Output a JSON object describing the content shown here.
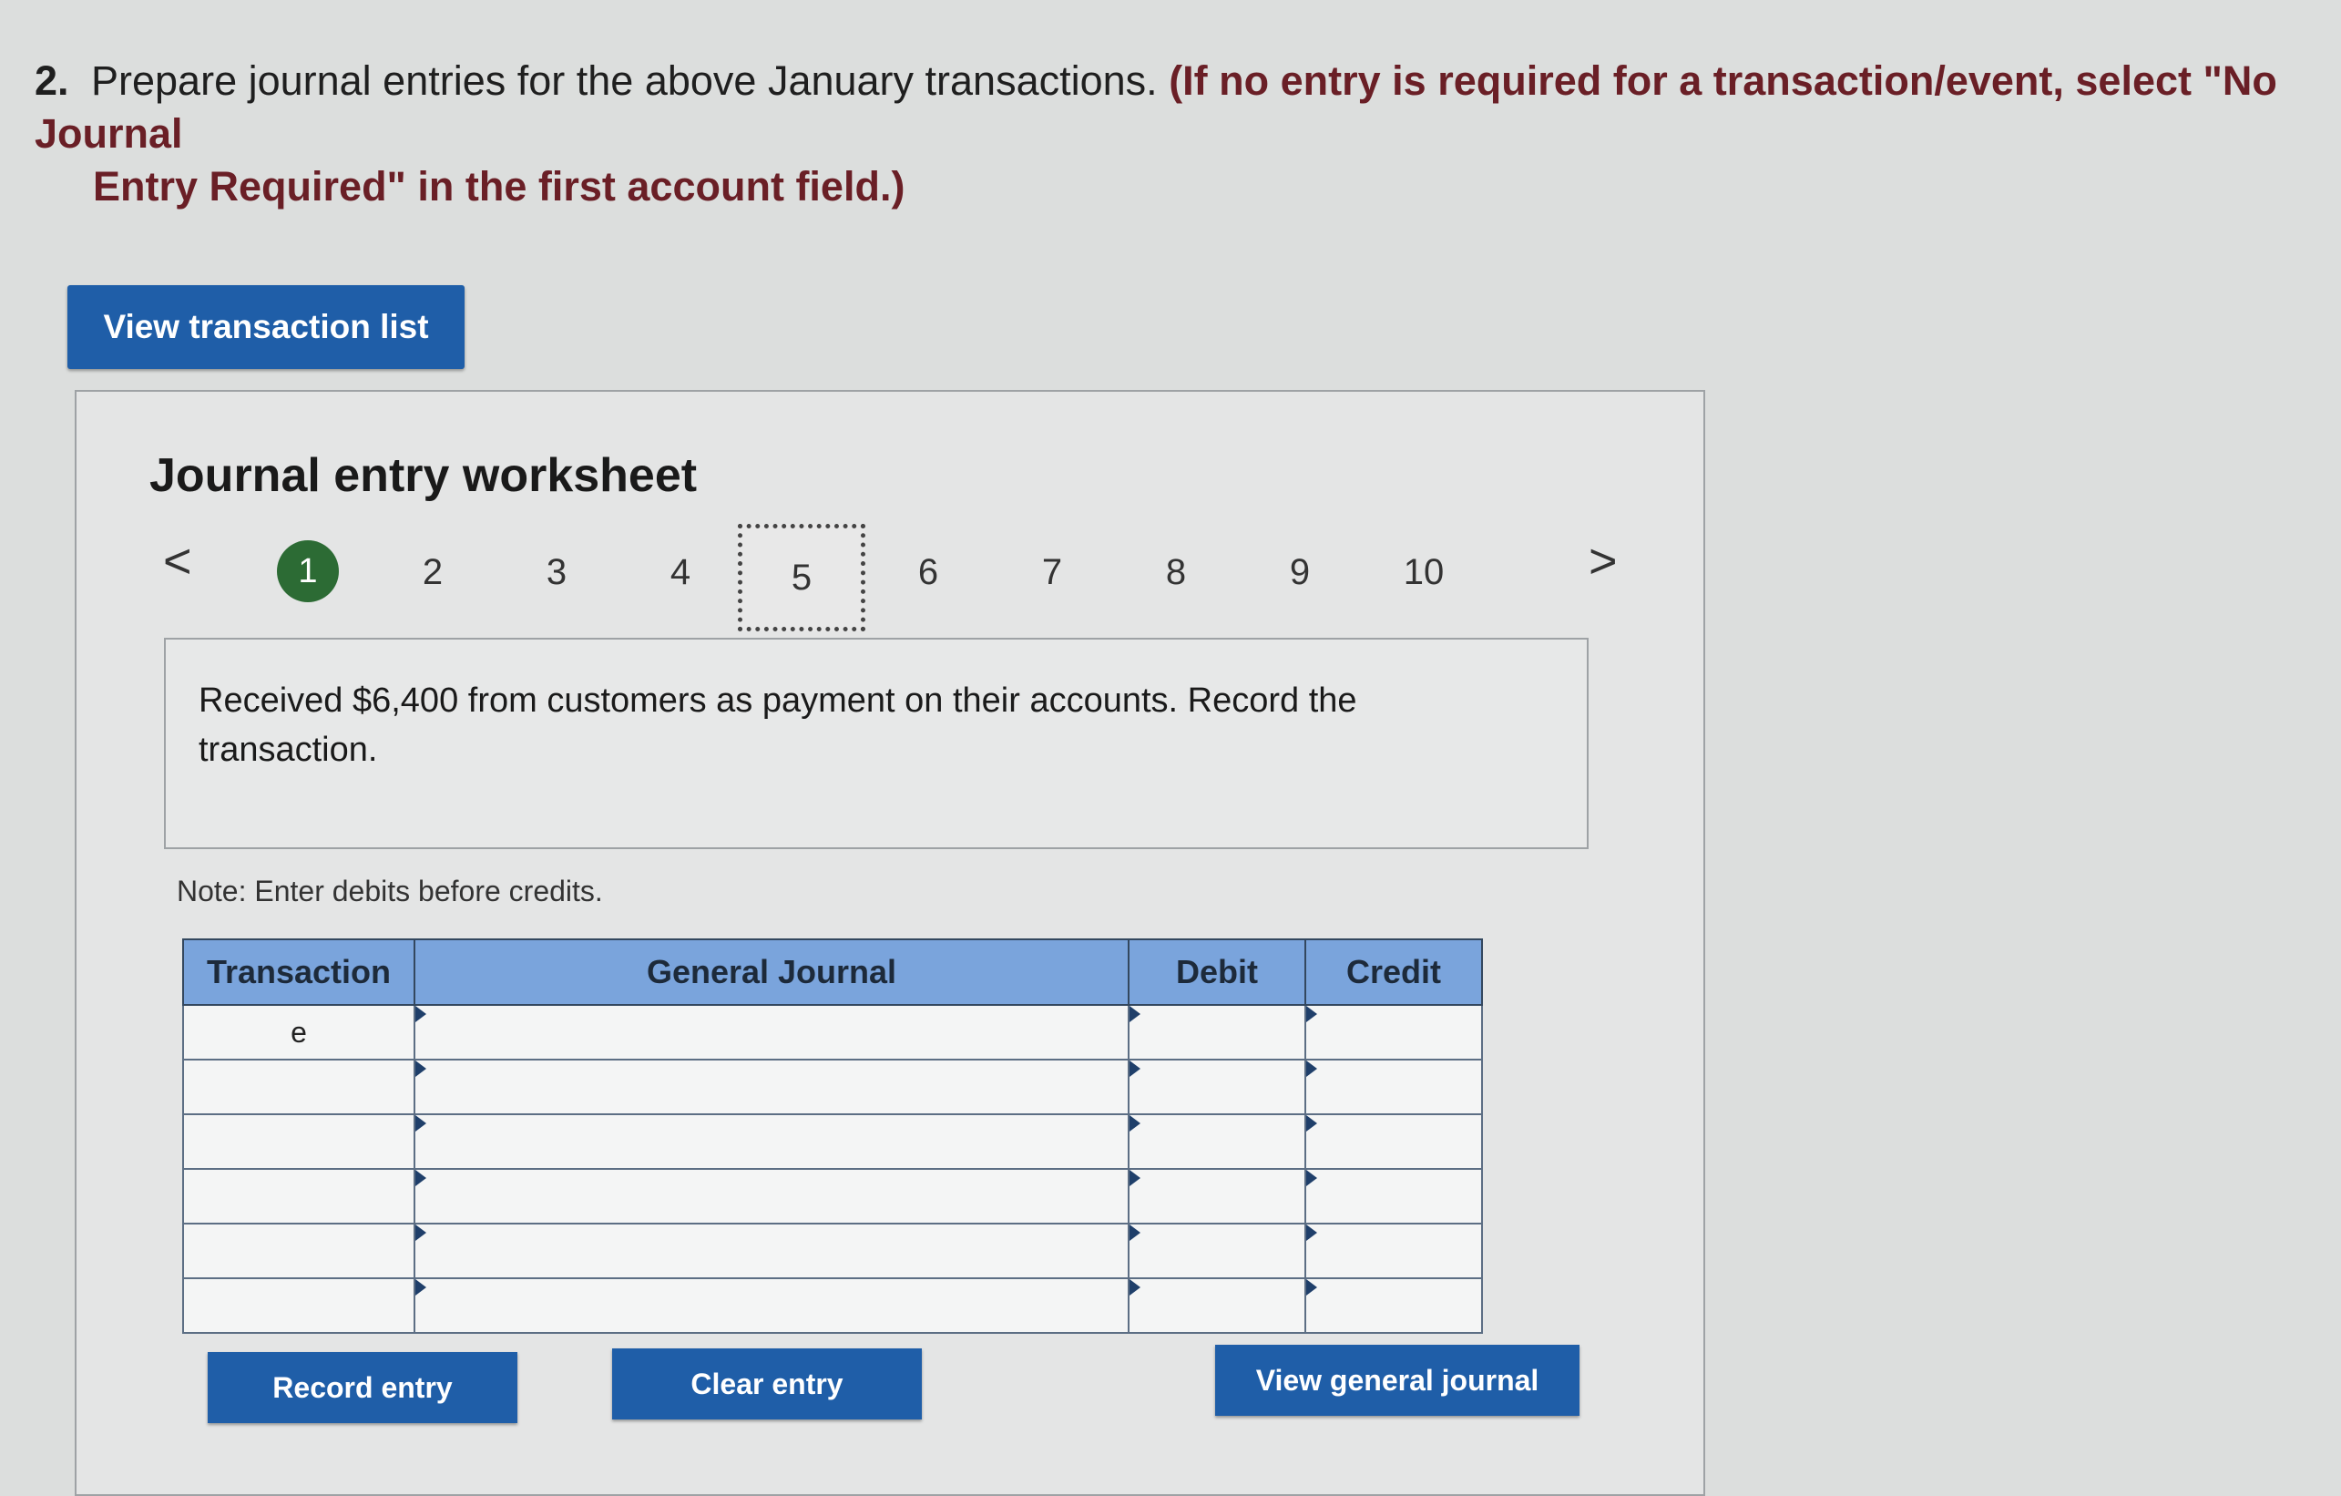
{
  "question": {
    "number": "2.",
    "text": "Prepare journal entries for the above January transactions.",
    "paren_line1": "(If no entry is required for a transaction/event, select \"No Journal",
    "paren_line2": "Entry Required\" in the first account field.)"
  },
  "buttons": {
    "view_transaction_list": "View transaction list",
    "record_entry": "Record entry",
    "clear_entry": "Clear entry",
    "view_general_journal": "View general journal"
  },
  "worksheet": {
    "title": "Journal entry worksheet",
    "pager": {
      "prev": "<",
      "next": ">",
      "pages": [
        "1",
        "2",
        "3",
        "4",
        "5",
        "6",
        "7",
        "8",
        "9",
        "10"
      ],
      "completed_page": "1",
      "current_page": "5"
    },
    "description": "Received $6,400 from customers as payment on their accounts. Record the transaction.",
    "note": "Note: Enter debits before credits.",
    "table": {
      "headers": [
        "Transaction",
        "General Journal",
        "Debit",
        "Credit"
      ],
      "rows": [
        [
          "e",
          "",
          "",
          ""
        ],
        [
          "",
          "",
          "",
          ""
        ],
        [
          "",
          "",
          "",
          ""
        ],
        [
          "",
          "",
          "",
          ""
        ],
        [
          "",
          "",
          "",
          ""
        ],
        [
          "",
          "",
          "",
          ""
        ]
      ]
    }
  }
}
